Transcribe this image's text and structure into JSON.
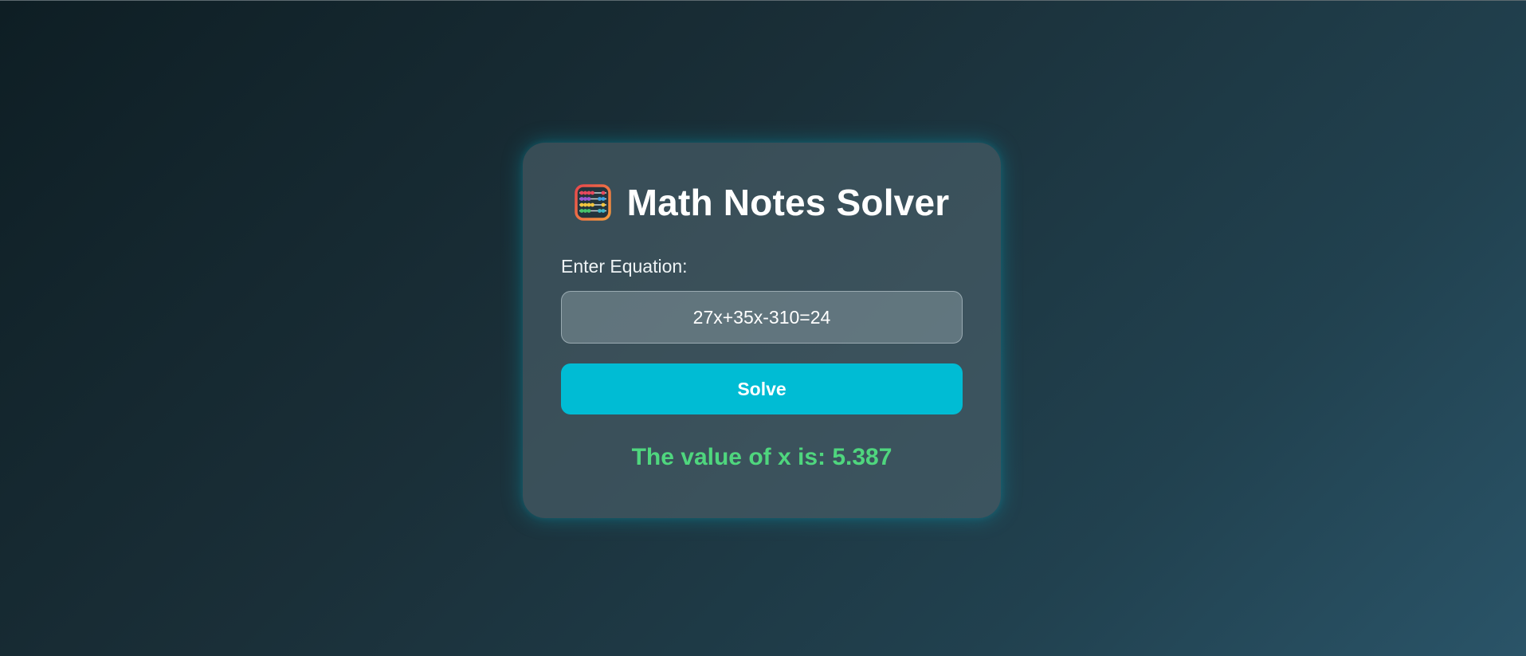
{
  "app": {
    "title": "Math Notes Solver",
    "title_icon": "abacus-icon"
  },
  "form": {
    "label": "Enter Equation:",
    "equation_value": "27x+35x-310=24",
    "solve_label": "Solve"
  },
  "result": {
    "text": "The value of x is: 5.387"
  },
  "colors": {
    "accent": "#00bcd4",
    "result": "#4fd67e",
    "card": "#4e626c",
    "background_start": "#0e1e24",
    "background_end": "#2a5468"
  }
}
